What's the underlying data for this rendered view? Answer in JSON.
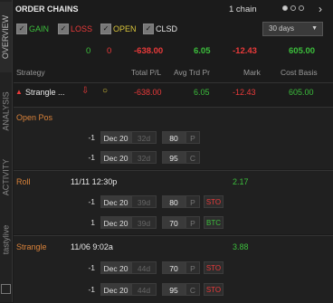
{
  "side_tabs": [
    "OVERVIEW",
    "ANALYSIS",
    "ACTIVITY",
    "tastylive"
  ],
  "header": {
    "title": "ORDER CHAINS",
    "count": "1 chain",
    "next_icon": "chevron-right-icon"
  },
  "filters": [
    {
      "label": "GAIN",
      "checked": true,
      "color": "#3cbf3c"
    },
    {
      "label": "LOSS",
      "checked": true,
      "color": "#ea3a3a"
    },
    {
      "label": "OPEN",
      "checked": true,
      "color": "#d9c43a"
    },
    {
      "label": "CLSD",
      "checked": true,
      "color": "#cfcfcf"
    }
  ],
  "days_select": "30 days",
  "totals": {
    "gain_count": "0",
    "loss_count": "0",
    "pl": "-638.00",
    "avg": "6.05",
    "mark": "-12.43",
    "basis": "605.00"
  },
  "columns": {
    "strategy": "Strategy",
    "total_pl": "Total P/L",
    "avg_trd_pr": "Avg Trd Pr",
    "mark": "Mark",
    "cost_basis": "Cost Basis"
  },
  "strategy_row": {
    "name": "Strangle ...",
    "total_pl": "-638.00",
    "avg": "6.05",
    "mark": "-12.43",
    "basis": "605.00"
  },
  "sections": {
    "open_pos": {
      "title": "Open Pos",
      "legs": [
        {
          "qty": "-1",
          "exp": "Dec 20",
          "dte": "32d",
          "strike": "80",
          "type": "P",
          "action": ""
        },
        {
          "qty": "-1",
          "exp": "Dec 20",
          "dte": "32d",
          "strike": "95",
          "type": "C",
          "action": ""
        }
      ]
    },
    "roll": {
      "title": "Roll",
      "time": "11/11 12:30p",
      "value": "2.17",
      "legs": [
        {
          "qty": "-1",
          "exp": "Dec 20",
          "dte": "39d",
          "strike": "80",
          "type": "P",
          "action": "STO"
        },
        {
          "qty": "1",
          "exp": "Dec 20",
          "dte": "39d",
          "strike": "70",
          "type": "P",
          "action": "BTC"
        }
      ]
    },
    "strangle": {
      "title": "Strangle",
      "time": "11/06 9:02a",
      "value": "3.88",
      "legs": [
        {
          "qty": "-1",
          "exp": "Dec 20",
          "dte": "44d",
          "strike": "70",
          "type": "P",
          "action": "STO"
        },
        {
          "qty": "-1",
          "exp": "Dec 20",
          "dte": "44d",
          "strike": "95",
          "type": "C",
          "action": "STO"
        }
      ]
    }
  }
}
